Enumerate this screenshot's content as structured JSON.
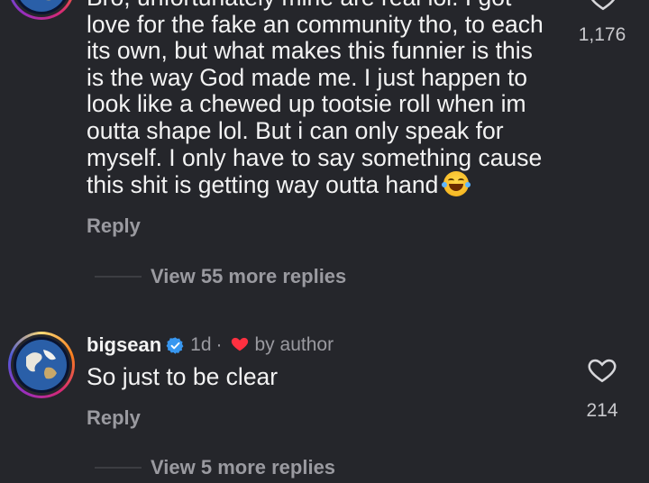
{
  "comment1": {
    "text": "Bro, unfortunately mine are real lol. I got\nlove for the fake an community tho, to each\nits own, but what makes this funnier is this\nis the way God made me. I just happen to\nlook like a chewed up tootsie roll when im\noutta shape lol. But i can only speak for\nmyself. I only have to say something cause\nthis shit is getting way outta hand",
    "emoji": "face-with-tears-of-joy",
    "reply_label": "Reply",
    "view_more_label": "View 55 more replies",
    "like_count": "1,176"
  },
  "comment2": {
    "username": "bigsean",
    "time": "1d",
    "separator": "·",
    "author_label": "by author",
    "text": "So just to be clear",
    "reply_label": "Reply",
    "like_count": "214",
    "view_more_label": "View 5 more replies"
  },
  "colors": {
    "background": "#25262b",
    "text": "#f3f3f3",
    "muted": "#9a9aa0",
    "verified_blue": "#3897f0",
    "heart_red": "#ff3040"
  },
  "icons": {
    "like": "heart-outline-icon",
    "verified": "verified-badge-icon",
    "liked_by_author": "red-heart-icon"
  }
}
